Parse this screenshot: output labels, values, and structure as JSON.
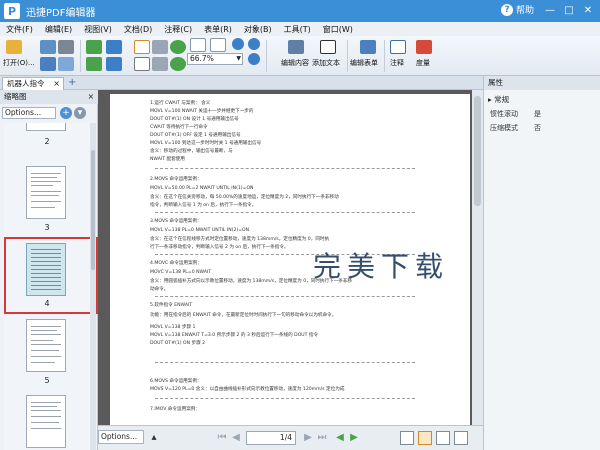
{
  "titlebar": {
    "logo": "P",
    "title": "迅捷PDF编辑器",
    "help": "帮助",
    "minimize": "—",
    "maximize": "□",
    "close": "✕"
  },
  "menu": [
    "文件(F)",
    "编辑(E)",
    "视图(V)",
    "文档(D)",
    "注释(C)",
    "表单(R)",
    "对象(B)",
    "工具(T)",
    "窗口(W)"
  ],
  "toolbar": {
    "open_label": "打开(O)...",
    "zoom_value": "66.7%",
    "edit_content": "编辑内容",
    "add_text": "添加文本",
    "edit_form": "编辑表单",
    "annotate": "注释",
    "measure": "度量"
  },
  "tabs": {
    "doc_tab": "机器人指令",
    "close": "×",
    "add": "+"
  },
  "thumbnails": {
    "header": "缩略图",
    "options": "Options...",
    "page_numbers": [
      "2",
      "3",
      "4",
      "5"
    ],
    "selected": "4"
  },
  "document": {
    "lines": [
      "1.运行 CWAIT  与案例：                                    含义",
      "MOVL V=100 NWAIT                           关运十一步并继更下一步的",
      "DOUT OT#(1) ON                              设计 1 号通用输出信号",
      "CWAIT                                              等待执行下一行命令",
      "DOUT OT#(1) OFF                            设定 1 号通用输出信号",
      "MOVL V=100                                    到达这一步时时时关 1 号通用输出信号",
      "含义：移动的过程中，输出信号最断，与",
      "NWAIT 配套使用",
      "2.MOVS 命令运用案例：",
      "MOVL   V=50.00   PL=2   NWAIT   UNTIL   IN(1)=ON",
      "含义：在这个在信关旁移动，每 50.00%的速度地运，定位精度为 2，同时执行下一条非移动",
      "指令，判断输入信号 1 为 on 后，执行下一条指令。",
      "3.MOVS 命令运用案例：",
      "MOVL   V=138   PL=0   NWAIT   UNTIL   IN(2)=ON",
      "含义：在这个在信程线移方式时定位置移动，速度为 138mm/s，定位精度为 0，同时执",
      "行下一条非移动指令，判断输入信号 2 为 on 后，执行下一条指令。",
      "4.MOVC  命令运用案例：",
      "MOVC    V=138    PL=0    NWAIT",
      "含义：用圆弧插补方式向以示教位置移动，速度为 138mm/s，定位精度为 0，同时执行下一条非移",
      "动命令。",
      "5.软件指令 ENWAIT",
      "功能：用在指令后的 ENWAIT 命令，在最新定位时时间执行下一句的移动命令以为机命令。",
      "MOVL V=138                                    步骤 1",
      "MOVL V=138 ENWAIT T=3.0           所示步骤 2 的 3 秒后运行下一条线的 DOUT 指令",
      "DOUT OT#(1)    ON                        步骤 2",
      "6.MOVS 命令运用案例：",
      "MOVS V=120 PL=0  含义：以自由曲线插补形式向示教位置移动，速度为 120mm/s  定位为成",
      "7.IMOV 命令运用案例："
    ],
    "watermark": "完美下载"
  },
  "bottombar": {
    "options": "Options...",
    "page_value": "1/4"
  },
  "properties": {
    "header": "属性",
    "section": "常规",
    "rows": [
      {
        "label": "惯性滚动",
        "value": "是"
      },
      {
        "label": "压缩模式",
        "value": "否"
      }
    ]
  }
}
